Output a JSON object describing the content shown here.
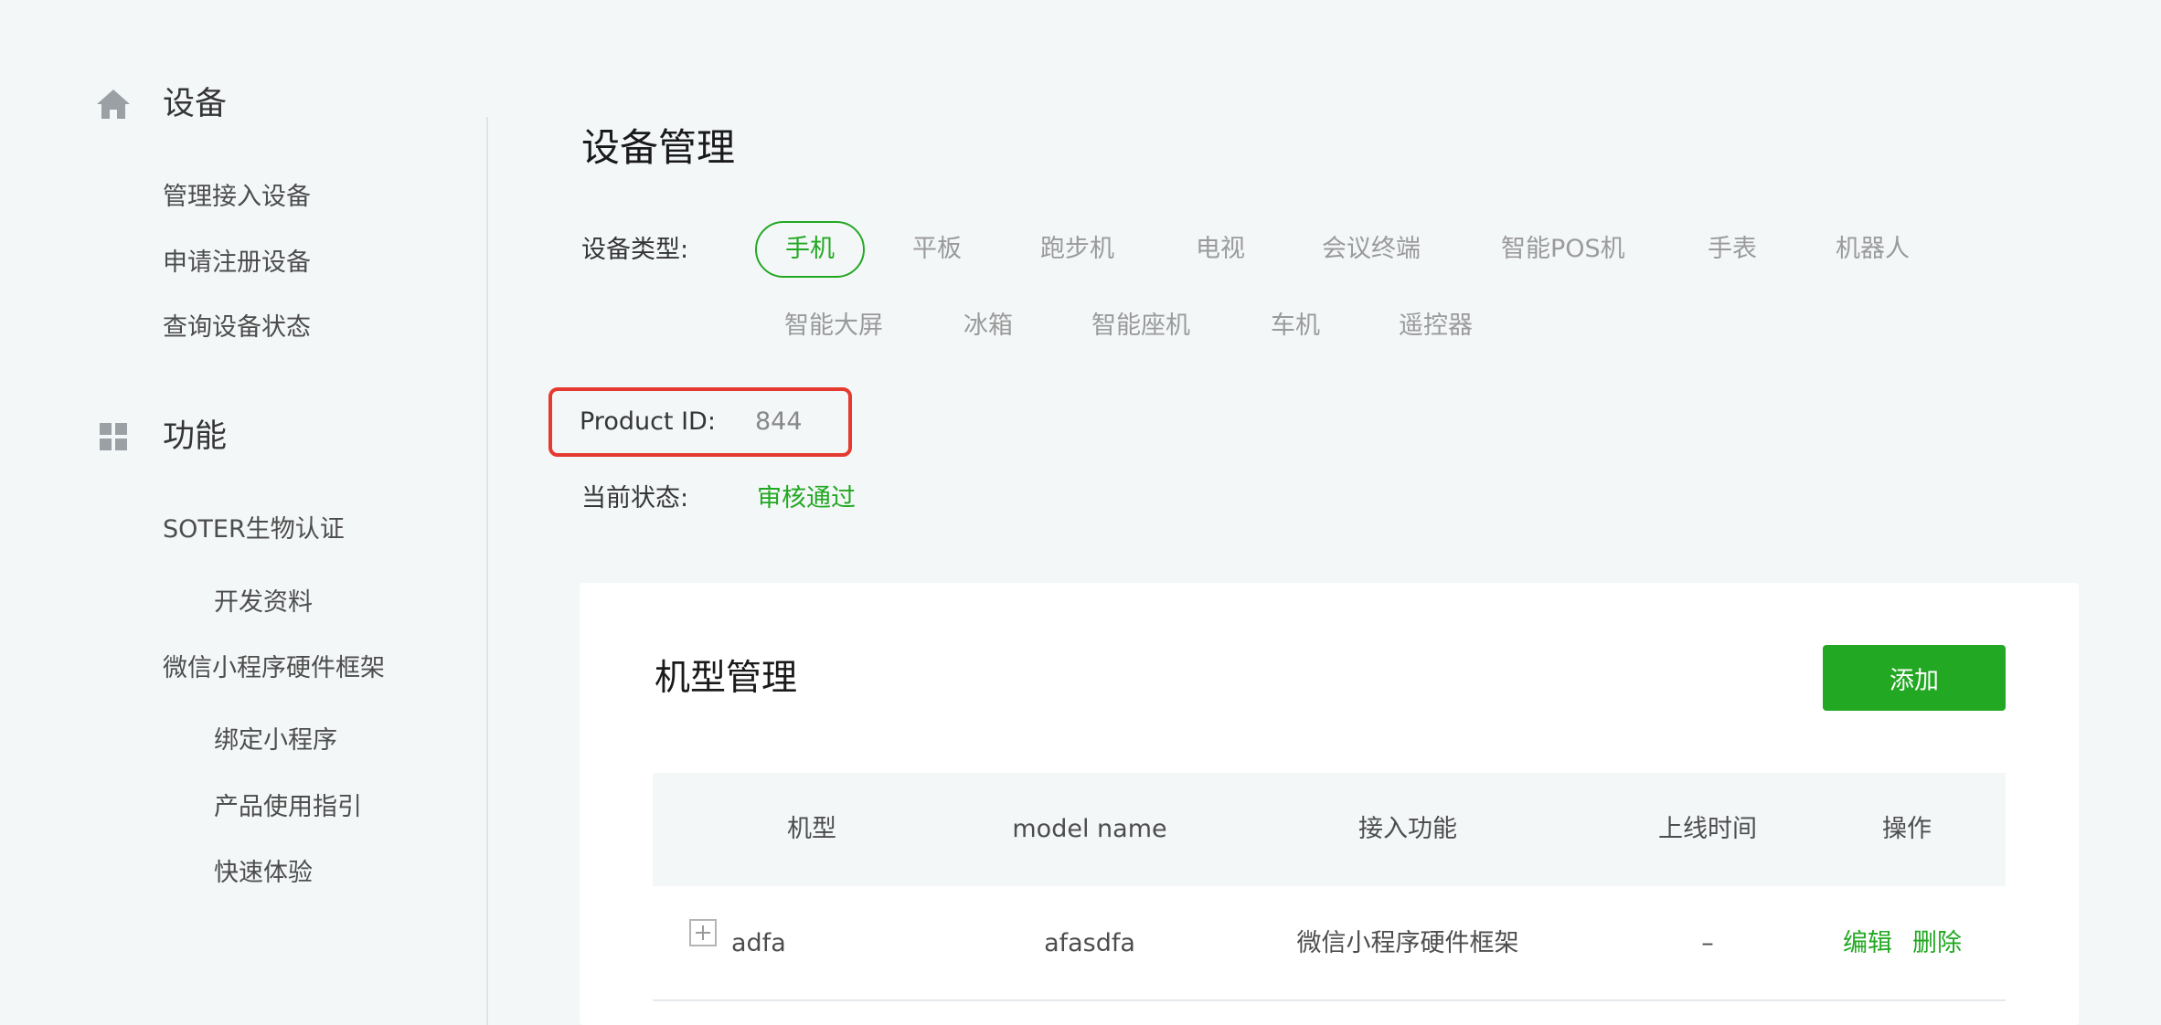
{
  "sidebar": {
    "device_group": {
      "icon": "home-icon",
      "label": "设备",
      "items": [
        "管理接入设备",
        "申请注册设备",
        "查询设备状态"
      ]
    },
    "feature_group": {
      "icon": "grid-icon",
      "label": "功能",
      "items": [
        {
          "label": "SOTER生物认证",
          "level": 1
        },
        {
          "label": "开发资料",
          "level": 2
        },
        {
          "label": "微信小程序硬件框架",
          "level": 1
        },
        {
          "label": "绑定小程序",
          "level": 2
        },
        {
          "label": "产品使用指引",
          "level": 2
        },
        {
          "label": "快速体验",
          "level": 2
        }
      ]
    }
  },
  "main": {
    "title": "设备管理",
    "device_type_label": "设备类型:",
    "device_types_row1": [
      "手机",
      "平板",
      "跑步机",
      "电视",
      "会议终端",
      "智能POS机",
      "手表",
      "机器人"
    ],
    "device_types_row2": [
      "智能大屏",
      "冰箱",
      "智能座机",
      "车机",
      "遥控器"
    ],
    "selected_type": "手机",
    "product_id_label": "Product ID:",
    "product_id_value": "844",
    "status_label": "当前状态:",
    "status_value": "审核通过"
  },
  "model_card": {
    "title": "机型管理",
    "add_button": "添加",
    "columns": [
      "机型",
      "model name",
      "接入功能",
      "上线时间",
      "操作"
    ],
    "rows": [
      {
        "model": "adfa",
        "model_name": "afasdfa",
        "feature": "微信小程序硬件框架",
        "online_time": "–",
        "actions": [
          "编辑",
          "删除"
        ]
      }
    ]
  },
  "colors": {
    "accent": "#22a822",
    "highlight_border": "#e53a2f",
    "background": "#f4f7f8"
  }
}
